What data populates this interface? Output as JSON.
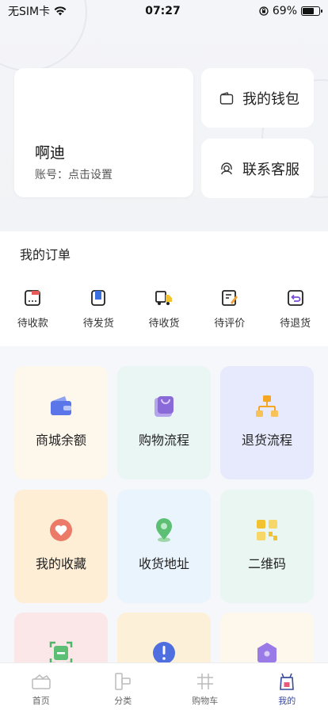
{
  "status_bar": {
    "carrier": "无SIM卡",
    "time": "07:27",
    "battery_percent": "69%",
    "battery_level": 0.69
  },
  "profile": {
    "name": "啊迪",
    "account_text": "账号：点击设置"
  },
  "quick_actions": {
    "wallet": "我的钱包",
    "support": "联系客服"
  },
  "orders": {
    "title": "我的订单",
    "items": [
      {
        "label": "待收款",
        "icon": "pending-payment-icon"
      },
      {
        "label": "待发货",
        "icon": "pending-shipment-icon"
      },
      {
        "label": "待收货",
        "icon": "pending-receipt-icon"
      },
      {
        "label": "待评价",
        "icon": "pending-review-icon"
      },
      {
        "label": "待退货",
        "icon": "pending-return-icon"
      }
    ]
  },
  "services": [
    {
      "label": "商城余额",
      "icon": "wallet-balance-icon",
      "bg": "#fdf7ec"
    },
    {
      "label": "购物流程",
      "icon": "shopping-process-icon",
      "bg": "#eaf6f3"
    },
    {
      "label": "退货流程",
      "icon": "return-process-icon",
      "bg": "#e7eafc"
    },
    {
      "label": "我的收藏",
      "icon": "favorites-icon",
      "bg": "#fdeed5"
    },
    {
      "label": "收货地址",
      "icon": "location-pin-icon",
      "bg": "#eaf4fd"
    },
    {
      "label": "二维码",
      "icon": "qr-code-icon",
      "bg": "#eaf6f1"
    },
    {
      "label": "",
      "icon": "scan-icon",
      "bg": "#fbe6e8"
    },
    {
      "label": "",
      "icon": "info-icon",
      "bg": "#fdf0d8"
    },
    {
      "label": "",
      "icon": "home-shield-icon",
      "bg": "#fdf7ec"
    }
  ],
  "tab_bar": [
    {
      "label": "首页",
      "icon": "home-icon",
      "active": false
    },
    {
      "label": "分类",
      "icon": "category-icon",
      "active": false
    },
    {
      "label": "购物车",
      "icon": "cart-icon",
      "active": false
    },
    {
      "label": "我的",
      "icon": "profile-icon",
      "active": true
    }
  ],
  "colors": {
    "accent": "#3a4a9c",
    "page_bg": "#f6f7fa"
  }
}
